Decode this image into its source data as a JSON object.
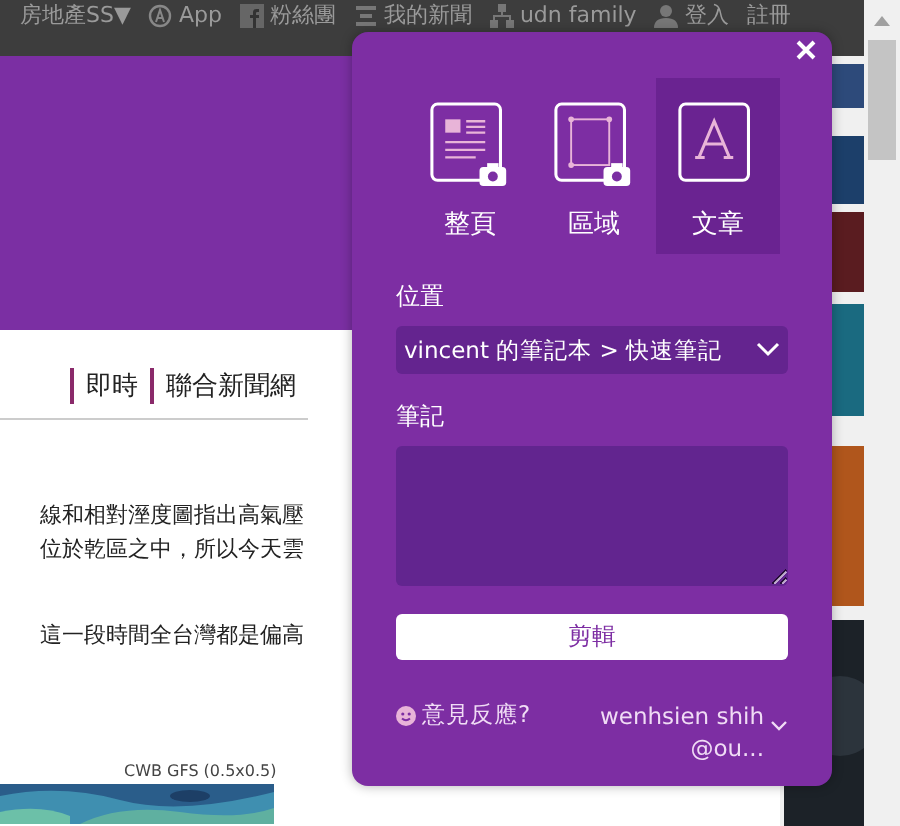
{
  "top_bar": {
    "links": [
      {
        "label": "房地產SS▼"
      },
      {
        "label": "App"
      },
      {
        "label": "粉絲團"
      },
      {
        "label": "我的新聞"
      },
      {
        "label": "udn family"
      },
      {
        "label": "登入"
      },
      {
        "label": "註冊"
      }
    ]
  },
  "nav": {
    "items": [
      "即時",
      "聯合新聞網"
    ]
  },
  "article": {
    "lines": [
      "線和相對溼度圖指出高氣壓",
      "位於乾區之中，所以今天雲",
      "這一段時間全台灣都是偏高"
    ],
    "chart_caption": "CWB GFS (0.5x0.5)"
  },
  "clipper": {
    "modes": [
      {
        "label": "整頁",
        "kind": "page",
        "selected": false
      },
      {
        "label": "區域",
        "kind": "region",
        "selected": false
      },
      {
        "label": "文章",
        "kind": "article",
        "selected": true
      }
    ],
    "location_label": "位置",
    "location": "vincent 的筆記本 > 快速筆記",
    "note_label": "筆記",
    "clip_button": "剪輯",
    "feedback": "意見反應?",
    "account": {
      "name": "wenhsien shih",
      "email": "@ou..."
    }
  }
}
